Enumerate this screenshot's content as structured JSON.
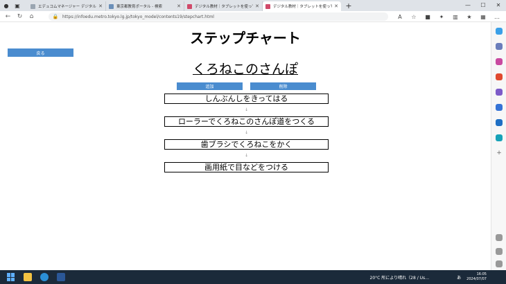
{
  "browser": {
    "tabs": [
      {
        "title": "エデュコムマネージャー デジタル…",
        "color": "#9aa5b1"
      },
      {
        "title": "東京都教育ポータル - 検索",
        "color": "#6b8fb8"
      },
      {
        "title": "デジタル教材｜タブレットを使って…",
        "color": "#d04a6a"
      },
      {
        "title": "デジタル教材｜タブレットを使って…",
        "color": "#d04a6a"
      }
    ],
    "new_tab": "+",
    "url": "https://infoedu.metro.tokyo.lg.jp/tokyo_model/contents19/stepchart.html",
    "window_controls": [
      "—",
      "☐",
      "✕"
    ]
  },
  "page": {
    "title": "ステップチャート",
    "back_label": "戻る",
    "subtitle": "くろねこのさんぽ",
    "add_label": "追加",
    "delete_label": "削除",
    "steps": [
      "しんぶんしをきってはる",
      "ローラーでくろねこのさんぽ道をつくる",
      "歯ブラシでくろねこをかく",
      "画用紙で目などをつける"
    ],
    "arrow": "↓"
  },
  "taskbar": {
    "weather": "20°C 所により晴れ（28 / Us…",
    "tray_text": "あ",
    "time": "16:05",
    "date": "2024/07/07"
  },
  "colors": {
    "accent_button": "#4a8ccf"
  }
}
